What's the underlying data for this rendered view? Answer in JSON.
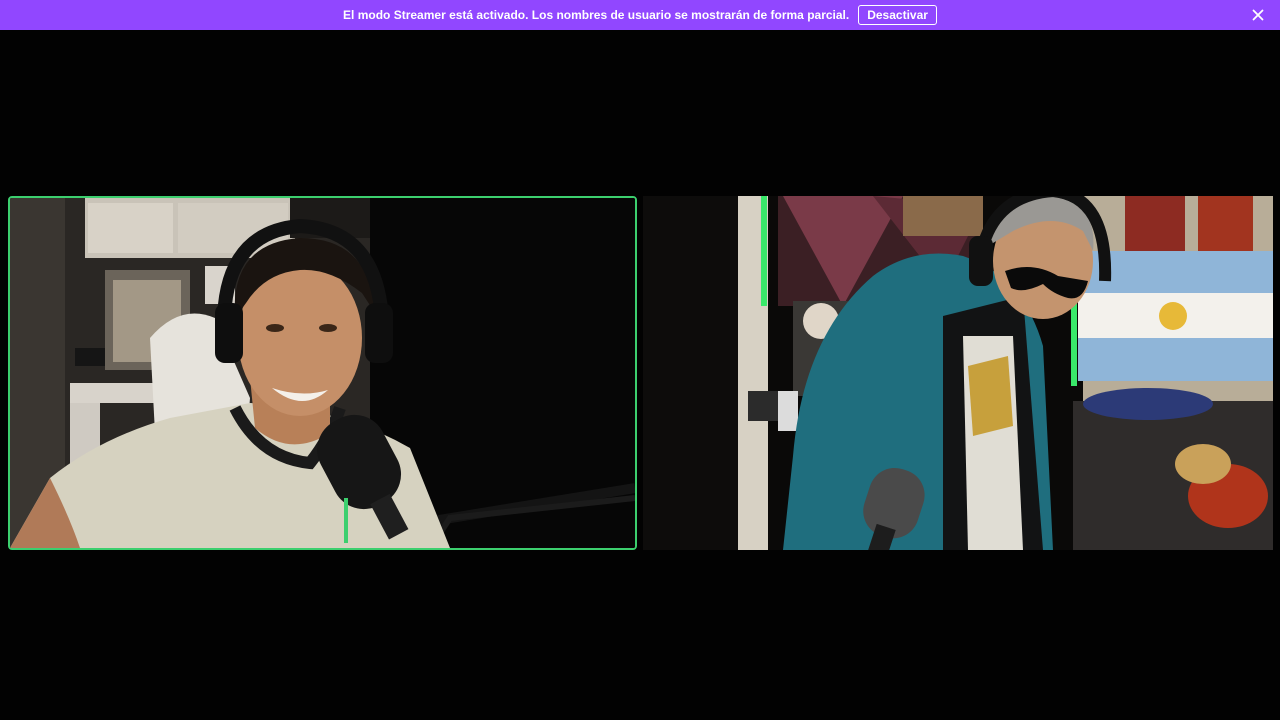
{
  "banner": {
    "message": "El modo Streamer está activado. Los nombres de usuario se mostrarán de forma parcial.",
    "deactivate_label": "Desactivar",
    "background_color": "#9147ff",
    "close_icon": "close-icon"
  },
  "video_grid": {
    "active_speaker_border_color": "#3ccf6e",
    "tiles": [
      {
        "active_speaker": true
      },
      {
        "active_speaker": false
      }
    ]
  }
}
